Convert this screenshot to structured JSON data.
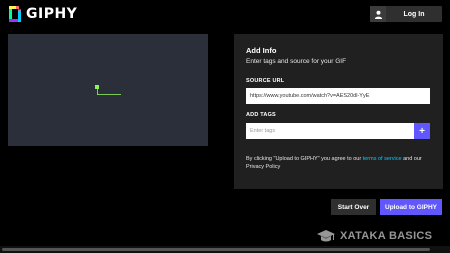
{
  "header": {
    "logo_text": "GIPHY",
    "login_label": "Log In",
    "login_icon": "user-icon"
  },
  "info": {
    "title": "Add Info",
    "subtitle": "Enter tags and source for your GIF",
    "source_url_label": "SOURCE URL",
    "source_url_value": "https://www.youtube.com/watch?v=AES20dl-YyE",
    "add_tags_label": "ADD TAGS",
    "tags_placeholder": "Enter tags",
    "add_tag_button": "+",
    "terms_prefix": "By clicking \"Upload to GIPHY\" you agree to our ",
    "terms_link": "terms of service",
    "terms_middle": " and our ",
    "privacy_text": "Privacy Policy"
  },
  "actions": {
    "start_over_label": "Start Over",
    "upload_label": "Upload to GIPHY"
  },
  "watermark": {
    "text": "XATAKA BASICS",
    "icon": "graduation-cap-icon"
  },
  "colors": {
    "accent": "#6157ff",
    "link": "#00ccff",
    "panel": "#202020",
    "preview_bg": "#2a2f3a",
    "crop_handle": "#8ef25a"
  }
}
